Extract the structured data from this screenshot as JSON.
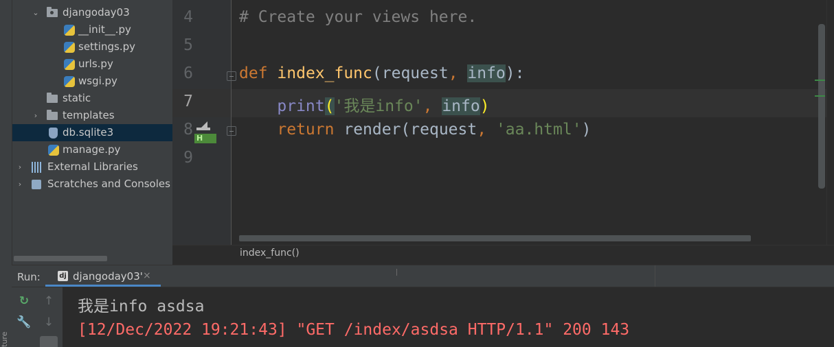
{
  "project_tree": {
    "items": [
      {
        "label": "djangoday03",
        "type": "package"
      },
      {
        "label": "__init__.py",
        "type": "python"
      },
      {
        "label": "settings.py",
        "type": "python"
      },
      {
        "label": "urls.py",
        "type": "python"
      },
      {
        "label": "wsgi.py",
        "type": "python"
      },
      {
        "label": "static",
        "type": "folder"
      },
      {
        "label": "templates",
        "type": "folder"
      },
      {
        "label": "db.sqlite3",
        "type": "database",
        "selected": true
      },
      {
        "label": "manage.py",
        "type": "python"
      },
      {
        "label": "External Libraries",
        "type": "libraries"
      },
      {
        "label": "Scratches and Consoles",
        "type": "scratches"
      }
    ]
  },
  "editor": {
    "line_numbers": [
      "4",
      "5",
      "6",
      "7",
      "8",
      "9"
    ],
    "current_line": "7",
    "lines": {
      "l4": {
        "comment": "# Create your views here."
      },
      "l6": {
        "kw": "def",
        "fn": "index_func",
        "open": "(",
        "p1": "request",
        "comma": ",",
        "p2": "info",
        "close": "):"
      },
      "l7": {
        "builtin": "print",
        "open": "(",
        "str": "'我是info'",
        "comma": ",",
        "arg": "info",
        "close": ")"
      },
      "l8": {
        "kw": "return",
        "call": "render(request",
        "comma": ",",
        "str": "'aa.html'",
        "close": ")"
      }
    },
    "gutter_badge": "H"
  },
  "breadcrumb": {
    "text": "index_func()"
  },
  "run_panel": {
    "label": "Run:",
    "tab_label": "djangoday03'",
    "tab_icon": "dj",
    "close_glyph": "×",
    "output_lines": [
      "我是info asdsa",
      "[12/Dec/2022 19:21:43] \"GET /index/asdsa HTTP/1.1\" 200 143"
    ]
  },
  "side_tool_label": "ture",
  "colors": {
    "keyword": "#cc7832",
    "function": "#ffc66d",
    "string": "#6a8759",
    "builtin": "#8888c6",
    "error_output": "#ff6b68",
    "selection": "#0d293e"
  }
}
